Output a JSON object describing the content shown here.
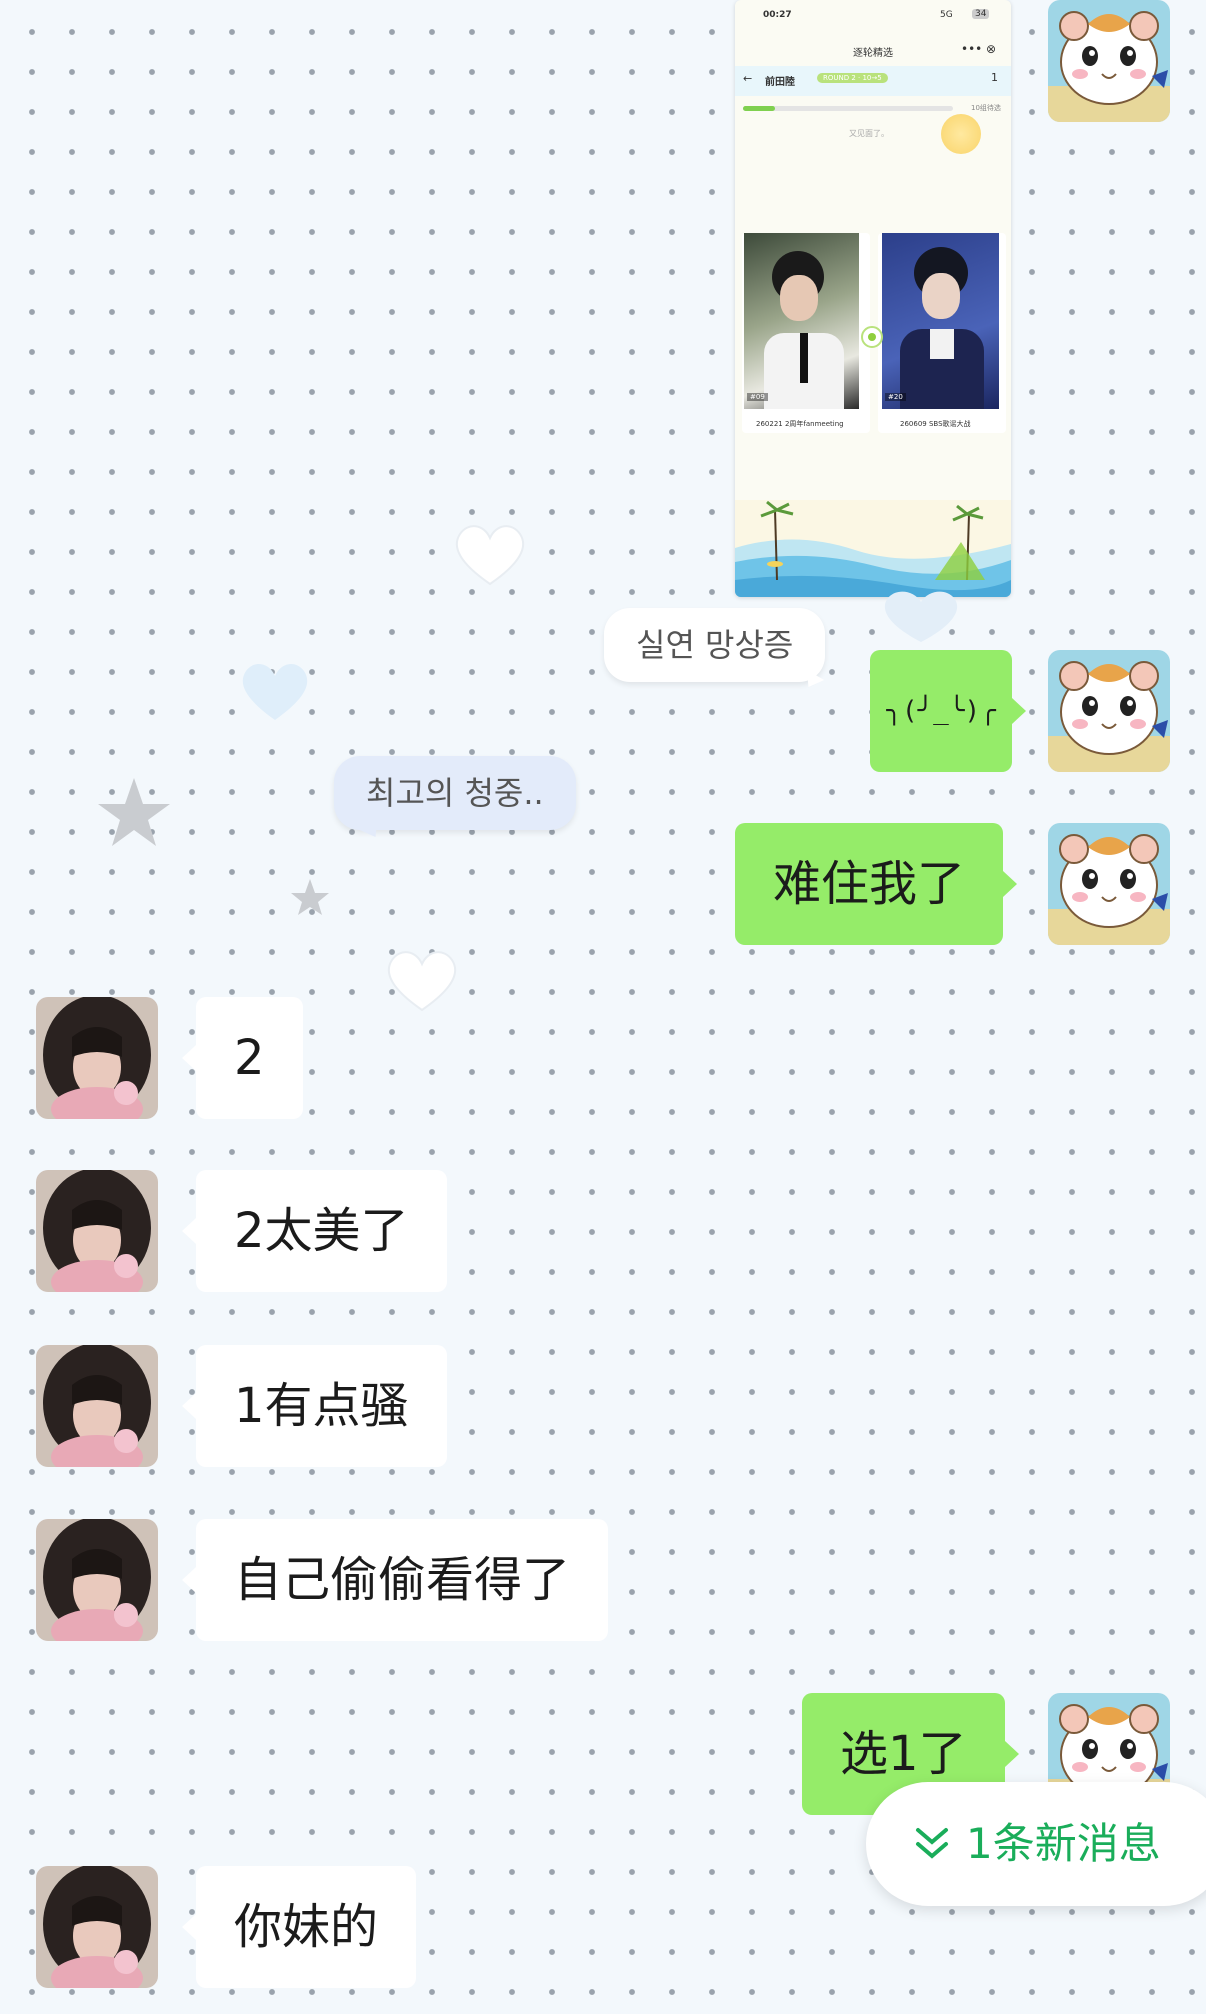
{
  "colors": {
    "outgoing_bubble": "#95ec69",
    "incoming_bubble": "#ffffff",
    "accent_green": "#1aad5a",
    "background": "#f3f8fc"
  },
  "screenshot": {
    "status_time": "00:27",
    "signal": "5G",
    "battery": "34",
    "title": "逐轮精选",
    "nav_name": "前田陸",
    "round_label": "ROUND 2 · 10→5",
    "counter": "1",
    "progress_text": "10组待选",
    "hint": "又见面了。",
    "progress": 0.15,
    "cards": [
      {
        "tag": "#09",
        "caption": "260221 2周年fanmeeting"
      },
      {
        "tag": "#20",
        "caption": "260609 SBS歌谣大战"
      }
    ]
  },
  "labels": {
    "label1": "실연 망상증",
    "label2": "최고의 청중.."
  },
  "messages": [
    {
      "side": "out",
      "text": "╮(╯_╰)╭"
    },
    {
      "side": "out",
      "text": "难住我了"
    },
    {
      "side": "in",
      "text": "2"
    },
    {
      "side": "in",
      "text": "2太美了"
    },
    {
      "side": "in",
      "text": "1有点骚"
    },
    {
      "side": "in",
      "text": "自己偷偷看得了"
    },
    {
      "side": "out",
      "text": "选1了"
    },
    {
      "side": "in",
      "text": "你妹的"
    }
  ],
  "new_message_pill": {
    "icon": "double-chevron-down-icon",
    "text": "1条新消息"
  }
}
